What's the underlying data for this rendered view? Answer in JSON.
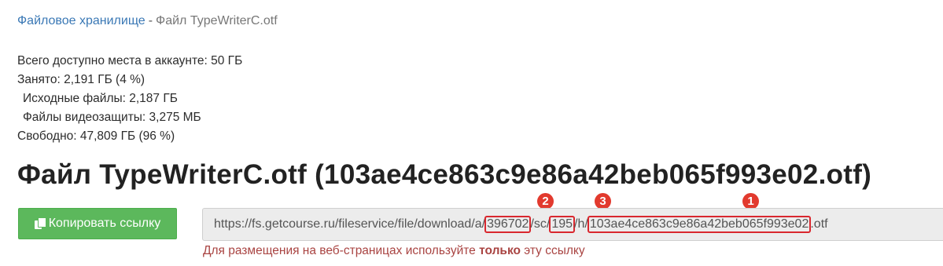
{
  "breadcrumb": {
    "root_label": "Файловое хранилище",
    "separator": "-",
    "current": "Файл TypeWriterC.otf"
  },
  "storage": {
    "total": "Всего доступно места в аккаунте: 50 ГБ",
    "used": "Занято: 2,191 ГБ (4 %)",
    "source_files": "Исходные файлы: 2,187 ГБ",
    "video_protection": "Файлы видеозащиты: 3,275 МБ",
    "free": "Свободно: 47,809 ГБ (96 %)"
  },
  "file": {
    "title": "Файл TypeWriterC.otf (103ae4ce863c9e86a42beb065f993e02.otf)"
  },
  "actions": {
    "copy_link_label": "Копировать ссылку"
  },
  "url": {
    "prefix": "https://fs.getcourse.ru/fileservice/file/download/a/",
    "account_id": "396702",
    "sep_sc": "/sc/",
    "sc_id": "195",
    "sep_h": "/h/",
    "hash": "103ae4ce863c9e86a42beb065f993e02",
    "ext": ".otf"
  },
  "markers": {
    "hash": "1",
    "account_id": "2",
    "sc_id": "3"
  },
  "notice": {
    "before": "Для размещения на веб-страницах используйте",
    "emphasis": "только",
    "after": "эту ссылку"
  },
  "colors": {
    "link": "#3a78b5",
    "button": "#5cb85c",
    "highlight": "#d9272e",
    "notice": "#a94442"
  }
}
